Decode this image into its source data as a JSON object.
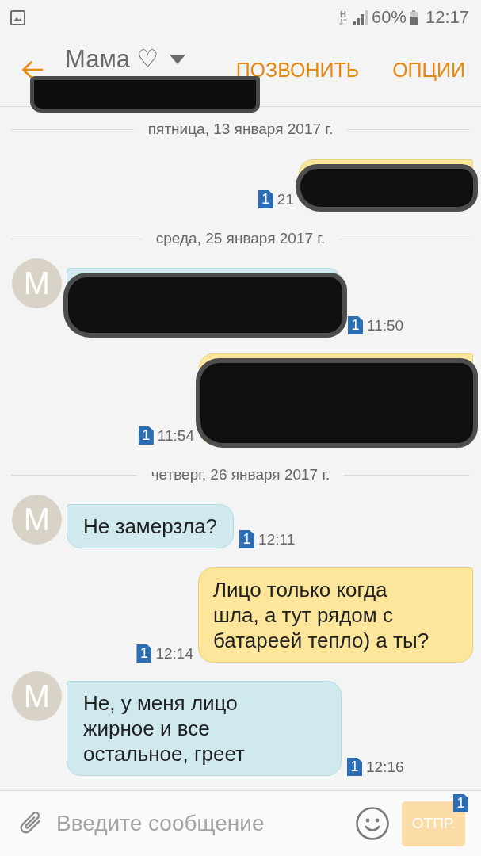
{
  "status_bar": {
    "network_type": "H",
    "battery": "60%",
    "time": "12:17"
  },
  "header": {
    "contact": "Мама ♡",
    "number_redacted": true,
    "actions": [
      {
        "kind": "call",
        "label": "ПОЗВОНИТЬ"
      },
      {
        "kind": "options",
        "label": "ОПЦИИ"
      }
    ]
  },
  "thread": [
    {
      "kind": "date",
      "text": "пятница, 13 января 2017 г."
    },
    {
      "kind": "outgoing",
      "redaction": {
        "kind": "single"
      },
      "sim": "1",
      "time": "21"
    },
    {
      "kind": "date",
      "text": "среда, 25 января 2017 г."
    },
    {
      "kind": "incoming",
      "avatar": "М",
      "redaction": {
        "kind": "double"
      },
      "sim": "1",
      "time": "11:50"
    },
    {
      "kind": "outgoing",
      "redaction": {
        "kind": "triple"
      },
      "sim": "1",
      "time": "11:54"
    },
    {
      "kind": "date",
      "text": "четверг, 26 января 2017 г."
    },
    {
      "kind": "incoming",
      "avatar": "М",
      "text": "Не замерзла?",
      "sim": "1",
      "time": "12:11"
    },
    {
      "kind": "outgoing",
      "text": "Лицо только когда\nшла, а тут рядом с\nбатареей тепло) а ты?",
      "sim": "1",
      "time": "12:14"
    },
    {
      "kind": "incoming",
      "avatar": "М",
      "text": "Не, у меня лицо\nжирное и все\nостальное, греет",
      "sim": "1",
      "time": "12:16"
    }
  ],
  "composer": {
    "placeholder": "Введите сообщение",
    "send_label": "ОТПР.",
    "send_disabled": true,
    "sim": "1"
  }
}
